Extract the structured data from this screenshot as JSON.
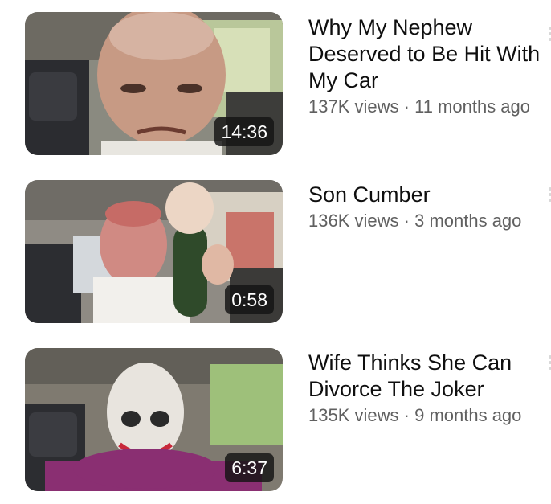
{
  "videos": [
    {
      "title": "Why My Nephew Deserved to Be Hit With My Car",
      "views": "137K views",
      "separator": "·",
      "age": "11 months ago",
      "duration": "14:36"
    },
    {
      "title": "Son Cumber",
      "views": "136K views",
      "separator": "·",
      "age": "3 months ago",
      "duration": "0:58"
    },
    {
      "title": "Wife Thinks She Can Divorce The Joker",
      "views": "135K views",
      "separator": "·",
      "age": "9 months ago",
      "duration": "6:37"
    }
  ],
  "icons": {
    "menu": "more-vert-icon"
  },
  "colors": {
    "title": "#0f0f0f",
    "meta": "#606060",
    "duration_bg": "#141414"
  }
}
